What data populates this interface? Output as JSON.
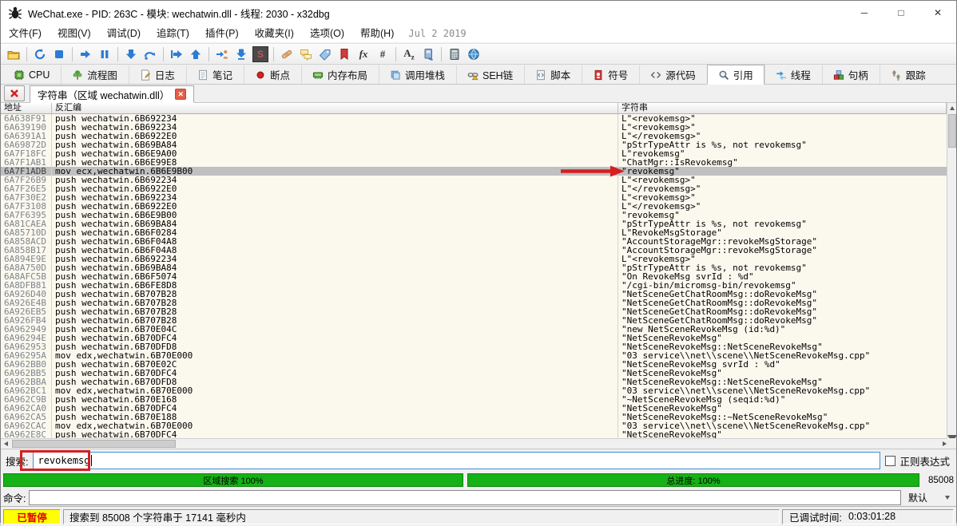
{
  "colors": {
    "progress_green": "#16b116",
    "selection_gray": "#c0c0c0",
    "annotation_red": "#d42020",
    "table_bg": "#fbf8ee"
  },
  "window": {
    "title": "WeChat.exe - PID: 263C - 模块: wechatwin.dll - 线程: 2030 - x32dbg",
    "controls": [
      "minimize",
      "maximize",
      "close"
    ]
  },
  "menu": {
    "items": [
      "文件(F)",
      "视图(V)",
      "调试(D)",
      "追踪(T)",
      "插件(P)",
      "收藏夹(I)",
      "选项(O)",
      "帮助(H)"
    ],
    "date": "Jul 2 2019"
  },
  "toolbar": {
    "icons": [
      "open-file-icon",
      "separator",
      "restart-icon",
      "stop-icon",
      "separator",
      "run-icon",
      "pause-icon",
      "separator",
      "step-into-icon",
      "step-over-icon",
      "separator",
      "execute-till-return-icon",
      "step-out-icon",
      "separator",
      "run-to-user-code-icon",
      "animate-into-icon",
      "s-toggle-icon",
      "separator",
      "patch-icon",
      "comment-icon",
      "label-icon",
      "bookmark-icon",
      "function-icon",
      "hash-icon",
      "separator",
      "text-encoding-icon",
      "memory-map-icon",
      "separator",
      "calculator-icon",
      "globe-icon"
    ]
  },
  "tabs": [
    {
      "icon": "cpu-tab-icon",
      "label": "CPU",
      "active": false
    },
    {
      "icon": "graph-tab-icon",
      "label": "流程图",
      "active": false
    },
    {
      "icon": "log-tab-icon",
      "label": "日志",
      "active": false
    },
    {
      "icon": "notes-tab-icon",
      "label": "笔记",
      "active": false
    },
    {
      "icon": "breakpoint-tab-icon",
      "label": "断点",
      "active": false
    },
    {
      "icon": "memory-tab-icon",
      "label": "内存布局",
      "active": false
    },
    {
      "icon": "callstack-tab-icon",
      "label": "调用堆栈",
      "active": false
    },
    {
      "icon": "seh-tab-icon",
      "label": "SEH链",
      "active": false
    },
    {
      "icon": "script-tab-icon",
      "label": "脚本",
      "active": false
    },
    {
      "icon": "symbols-tab-icon",
      "label": "符号",
      "active": false
    },
    {
      "icon": "source-tab-icon",
      "label": "源代码",
      "active": false
    },
    {
      "icon": "references-tab-icon",
      "label": "引用",
      "active": true
    },
    {
      "icon": "threads-tab-icon",
      "label": "线程",
      "active": false
    },
    {
      "icon": "handles-tab-icon",
      "label": "句柄",
      "active": false
    },
    {
      "icon": "trace-tab-icon",
      "label": "跟踪",
      "active": false
    }
  ],
  "doc_tab": {
    "label": "字符串（区域 wechatwin.dll）",
    "close_glyph": "✕"
  },
  "table": {
    "columns": [
      "地址",
      "反汇编",
      "字符串"
    ],
    "highlight": "revokemsg",
    "selected_index": 6,
    "rows": [
      [
        "6A638F91",
        "push wechatwin.6B692234",
        "L\"<revokemsg>\""
      ],
      [
        "6A639190",
        "push wechatwin.6B692234",
        "L\"<revokemsg>\""
      ],
      [
        "6A6391A1",
        "push wechatwin.6B6922E0",
        "L\"</revokemsg>\""
      ],
      [
        "6A69872D",
        "push wechatwin.6B69BA84",
        "\"pStrTypeAttr is %s, not revokemsg\""
      ],
      [
        "6A7F18FC",
        "push wechatwin.6B6E9A00",
        "L\"revokemsg\""
      ],
      [
        "6A7F1AB1",
        "push wechatwin.6B6E99E8",
        "\"ChatMgr::IsRevokemsg\""
      ],
      [
        "6A7F1ADB",
        "mov ecx,wechatwin.6B6E9B00",
        "\"revokemsg\""
      ],
      [
        "6A7F26B9",
        "push wechatwin.6B692234",
        "L\"<revokemsg>\""
      ],
      [
        "6A7F26E5",
        "push wechatwin.6B6922E0",
        "L\"</revokemsg>\""
      ],
      [
        "6A7F30E2",
        "push wechatwin.6B692234",
        "L\"<revokemsg>\""
      ],
      [
        "6A7F3108",
        "push wechatwin.6B6922E0",
        "L\"</revokemsg>\""
      ],
      [
        "6A7F6395",
        "push wechatwin.6B6E9B00",
        "\"revokemsg\""
      ],
      [
        "6A81CAEA",
        "push wechatwin.6B69BA84",
        "\"pStrTypeAttr is %s, not revokemsg\""
      ],
      [
        "6A85710D",
        "push wechatwin.6B6F0284",
        "L\"RevokeMsgStorage\""
      ],
      [
        "6A858ACD",
        "push wechatwin.6B6F04A8",
        "\"AccountStorageMgr::revokeMsgStorage\""
      ],
      [
        "6A858B17",
        "push wechatwin.6B6F04A8",
        "\"AccountStorageMgr::revokeMsgStorage\""
      ],
      [
        "6A894E9E",
        "push wechatwin.6B692234",
        "L\"<revokemsg>\""
      ],
      [
        "6A8A750D",
        "push wechatwin.6B69BA84",
        "\"pStrTypeAttr is %s, not revokemsg\""
      ],
      [
        "6A8AFC5B",
        "push wechatwin.6B6F5074",
        "\"On RevokeMsg svrId : %d\""
      ],
      [
        "6A8DFB81",
        "push wechatwin.6B6FE8D8",
        "\"/cgi-bin/micromsg-bin/revokemsg\""
      ],
      [
        "6A926D40",
        "push wechatwin.6B707B28",
        "\"NetSceneGetChatRoomMsg::doRevokeMsg\""
      ],
      [
        "6A926E4B",
        "push wechatwin.6B707B28",
        "\"NetSceneGetChatRoomMsg::doRevokeMsg\""
      ],
      [
        "6A926EB5",
        "push wechatwin.6B707B28",
        "\"NetSceneGetChatRoomMsg::doRevokeMsg\""
      ],
      [
        "6A926FB4",
        "push wechatwin.6B707B28",
        "\"NetSceneGetChatRoomMsg::doRevokeMsg\""
      ],
      [
        "6A962949",
        "push wechatwin.6B70E04C",
        "\"new NetSceneRevokeMsg (id:%d)\""
      ],
      [
        "6A96294E",
        "push wechatwin.6B70DFC4",
        "\"NetSceneRevokeMsg\""
      ],
      [
        "6A962953",
        "push wechatwin.6B70DFD8",
        "\"NetSceneRevokeMsg::NetSceneRevokeMsg\""
      ],
      [
        "6A96295A",
        "mov edx,wechatwin.6B70E000",
        "\"03_service\\\\net\\\\scene\\\\NetSceneRevokeMsg.cpp\""
      ],
      [
        "6A962BB0",
        "push wechatwin.6B70E02C",
        "\"NetSceneRevokeMsg svrId : %d\""
      ],
      [
        "6A962BB5",
        "push wechatwin.6B70DFC4",
        "\"NetSceneRevokeMsg\""
      ],
      [
        "6A962BBA",
        "push wechatwin.6B70DFD8",
        "\"NetSceneRevokeMsg::NetSceneRevokeMsg\""
      ],
      [
        "6A962BC1",
        "mov edx,wechatwin.6B70E000",
        "\"03_service\\\\net\\\\scene\\\\NetSceneRevokeMsg.cpp\""
      ],
      [
        "6A962C9B",
        "push wechatwin.6B70E168",
        "\"~NetSceneRevokeMsg (seqid:%d)\""
      ],
      [
        "6A962CA0",
        "push wechatwin.6B70DFC4",
        "\"NetSceneRevokeMsg\""
      ],
      [
        "6A962CA5",
        "push wechatwin.6B70E188",
        "\"NetSceneRevokeMsg::~NetSceneRevokeMsg\""
      ],
      [
        "6A962CAC",
        "mov edx,wechatwin.6B70E000",
        "\"03_service\\\\net\\\\scene\\\\NetSceneRevokeMsg.cpp\""
      ],
      [
        "6A962E8C",
        "push wechatwin.6B70DFC4",
        "\"NetSceneRevokeMsg\""
      ]
    ]
  },
  "search": {
    "label": "搜索:",
    "value": "revokemsg",
    "regex_label": "正则表达式",
    "regex_checked": false
  },
  "progress": {
    "left_label": "区域搜索 100%",
    "right_label": "总进度: 100%",
    "count": "85008"
  },
  "command": {
    "label": "命令:",
    "value": "",
    "profile": "默认"
  },
  "status": {
    "state": "已暂停",
    "message": "搜索到 85008 个字符串于 17141 毫秒内",
    "debug_time_label": "已调试时间:",
    "debug_time_value": "0:03:01:28"
  }
}
